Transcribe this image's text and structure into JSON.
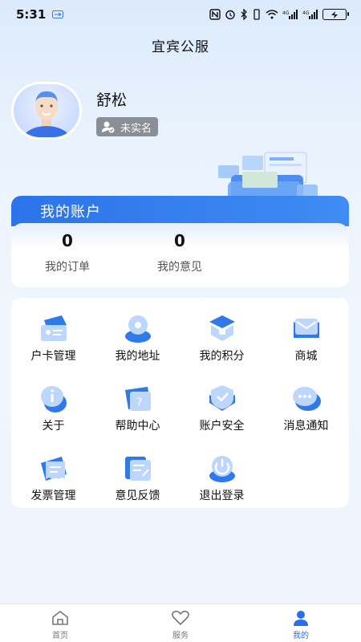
{
  "status": {
    "time": "5:31",
    "battery_icon": "battery-charging-icon",
    "network": "4G"
  },
  "header": {
    "title": "宜宾公服"
  },
  "profile": {
    "name": "舒松",
    "verify_status": "未实名"
  },
  "account": {
    "title": "我的账户",
    "stats": [
      {
        "value": "0",
        "label": "我的订单"
      },
      {
        "value": "0",
        "label": "我的意见"
      }
    ]
  },
  "menu": {
    "items": [
      {
        "label": "户卡管理",
        "icon": "card-icon"
      },
      {
        "label": "我的地址",
        "icon": "location-icon"
      },
      {
        "label": "我的积分",
        "icon": "points-icon"
      },
      {
        "label": "商城",
        "icon": "mail-icon"
      },
      {
        "label": "关于",
        "icon": "info-icon"
      },
      {
        "label": "帮助中心",
        "icon": "help-icon"
      },
      {
        "label": "账户安全",
        "icon": "shield-icon"
      },
      {
        "label": "消息通知",
        "icon": "chat-icon"
      },
      {
        "label": "发票管理",
        "icon": "invoice-icon"
      },
      {
        "label": "意见反馈",
        "icon": "feedback-icon"
      },
      {
        "label": "退出登录",
        "icon": "power-icon"
      }
    ]
  },
  "tabbar": {
    "tabs": [
      {
        "label": "首页",
        "icon": "home-icon"
      },
      {
        "label": "服务",
        "icon": "heart-icon"
      },
      {
        "label": "我的",
        "icon": "user-icon"
      }
    ],
    "active": "我的"
  },
  "colors": {
    "accent": "#2b6fe6",
    "icon_light": "#bcd7fb"
  }
}
